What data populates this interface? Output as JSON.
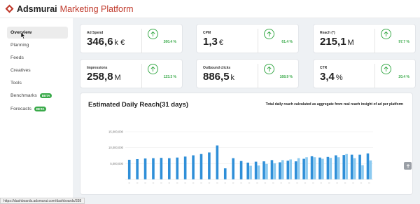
{
  "app": {
    "brand": "Adsmurai",
    "product": "Marketing Platform"
  },
  "sidebar": {
    "items": [
      {
        "label": "Overview",
        "active": true,
        "beta": ""
      },
      {
        "label": "Planning",
        "active": false,
        "beta": ""
      },
      {
        "label": "Feeds",
        "active": false,
        "beta": ""
      },
      {
        "label": "Creatives",
        "active": false,
        "beta": ""
      },
      {
        "label": "Tools",
        "active": false,
        "beta": ""
      },
      {
        "label": "Benchmarks",
        "active": false,
        "beta": "BETA"
      },
      {
        "label": "Forecasts",
        "active": false,
        "beta": "BETA"
      }
    ]
  },
  "kpis": [
    {
      "label": "Ad Spend",
      "value": "346,6",
      "unit": "k €",
      "change": "260.4 %"
    },
    {
      "label": "CPM",
      "value": "1,3",
      "unit": "€",
      "change": "61.4 %"
    },
    {
      "label": "Reach (*)",
      "value": "215,1",
      "unit": "M",
      "change": "97.7 %"
    },
    {
      "label": "Impressions",
      "value": "258,8",
      "unit": "M",
      "change": "123.3 %"
    },
    {
      "label": "Outbound clicks",
      "value": "886,5",
      "unit": "k",
      "change": "168.9 %"
    },
    {
      "label": "CTR",
      "value": "3,4",
      "unit": "%",
      "change": "20.4 %"
    }
  ],
  "colors": {
    "positive": "#3aaa4a",
    "bar_dark": "#2f8fd8",
    "bar_light": "#8ccaf0",
    "brand_red": "#c0392b"
  },
  "chart": {
    "title": "Estimated Daily Reach(31 days)",
    "subtitle": "Total daily reach calculated as aggregate from real reach insight of ad per platform"
  },
  "chart_data": {
    "type": "bar",
    "title": "Estimated Daily Reach(31 days)",
    "xlabel": "",
    "ylabel": "",
    "ylim": [
      0,
      15000000
    ],
    "yticks": [
      "15,000,000",
      "10,000,000",
      "5,000,000",
      "0"
    ],
    "grid": true,
    "series": [
      {
        "values": [
          6200000,
          6400000,
          6600000,
          6700000,
          6800000,
          6700000,
          6900000,
          7200000,
          7600000,
          8000000,
          8500000,
          10700000,
          3500000,
          6700000,
          5800000,
          5300000,
          5600000,
          5700000,
          6100000,
          5400000,
          5900000,
          5700000,
          6500000,
          7300000,
          6900000,
          7100000,
          7600000,
          7700000,
          7800000,
          7800000,
          8200000
        ]
      },
      {
        "values": [
          null,
          null,
          null,
          null,
          null,
          null,
          null,
          null,
          null,
          null,
          null,
          null,
          null,
          null,
          null,
          4300000,
          4400000,
          4900000,
          5100000,
          6100000,
          6300000,
          6700000,
          7000000,
          7000000,
          6500000,
          6800000,
          7000000,
          8000000,
          6700000,
          4500000,
          6000000
        ]
      }
    ]
  },
  "statusbar": {
    "url": "https://dashboards.adsmurai.com/dashboards/338"
  }
}
